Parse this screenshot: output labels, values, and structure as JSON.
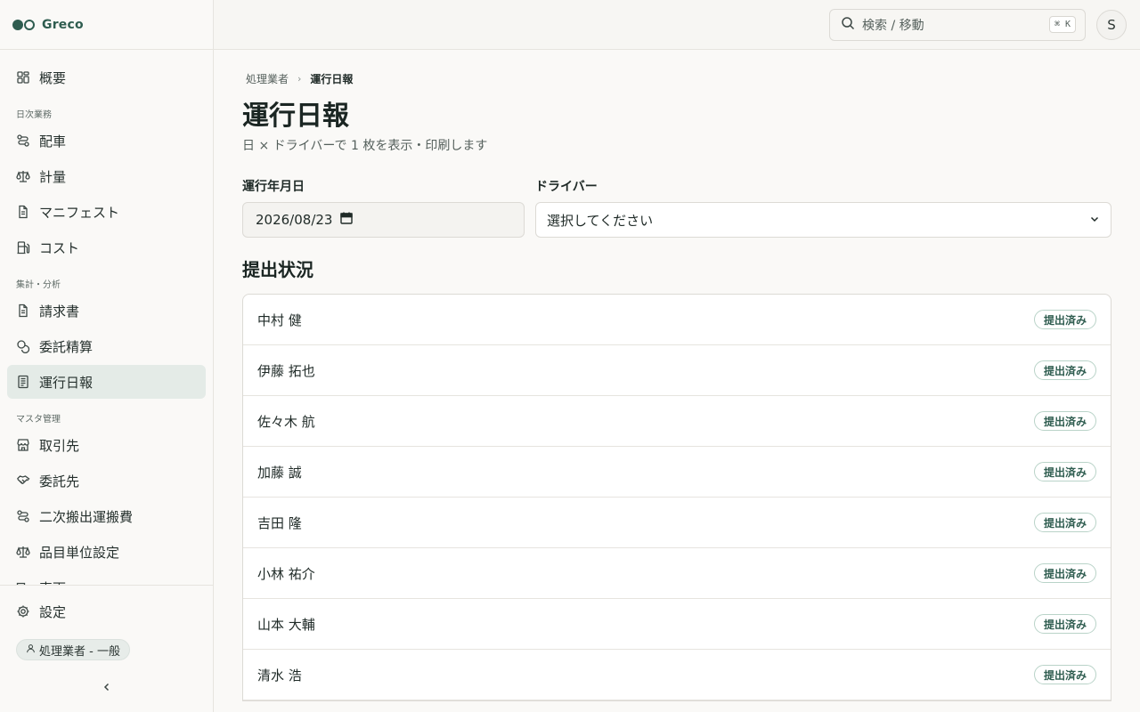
{
  "app": {
    "name": "Greco"
  },
  "sidebar": {
    "top_item": {
      "label": "概要",
      "icon": "dashboard-icon"
    },
    "groups": [
      {
        "label": "日次業務",
        "items": [
          {
            "label": "配車",
            "icon": "route-icon"
          },
          {
            "label": "計量",
            "icon": "scale-icon"
          },
          {
            "label": "マニフェスト",
            "icon": "document-icon"
          },
          {
            "label": "コスト",
            "icon": "fuel-icon"
          }
        ]
      },
      {
        "label": "集計・分析",
        "items": [
          {
            "label": "請求書",
            "icon": "document-icon"
          },
          {
            "label": "委託精算",
            "icon": "coins-icon"
          },
          {
            "label": "運行日報",
            "icon": "report-icon",
            "active": true
          }
        ]
      },
      {
        "label": "マスタ管理",
        "items": [
          {
            "label": "取引先",
            "icon": "store-icon"
          },
          {
            "label": "委託先",
            "icon": "handshake-icon"
          },
          {
            "label": "二次搬出運搬費",
            "icon": "route-icon"
          },
          {
            "label": "品目単位設定",
            "icon": "scale-icon"
          },
          {
            "label": "車両",
            "icon": "truck-icon"
          }
        ]
      }
    ],
    "footer": {
      "settings_label": "設定",
      "role_label": "処理業者 - 一般"
    }
  },
  "topbar": {
    "search_placeholder": "検索 / 移動",
    "shortcut": "⌘ K",
    "avatar_initial": "S"
  },
  "breadcrumb": {
    "parent": "処理業者",
    "current": "運行日報"
  },
  "page": {
    "title": "運行日報",
    "subtitle": "日 × ドライバーで 1 枚を表示・印刷します"
  },
  "filters": {
    "date_label": "運行年月日",
    "date_value": "2026/08/23",
    "driver_label": "ドライバー",
    "driver_value": "選択してください"
  },
  "submissions": {
    "title": "提出状況",
    "rows": [
      {
        "name": "中村 健",
        "status": "提出済み"
      },
      {
        "name": "伊藤 拓也",
        "status": "提出済み"
      },
      {
        "name": "佐々木 航",
        "status": "提出済み"
      },
      {
        "name": "加藤 誠",
        "status": "提出済み"
      },
      {
        "name": "吉田 隆",
        "status": "提出済み"
      },
      {
        "name": "小林 祐介",
        "status": "提出済み"
      },
      {
        "name": "山本 大輔",
        "status": "提出済み"
      },
      {
        "name": "清水 浩",
        "status": "提出済み"
      }
    ]
  },
  "colors": {
    "accent": "#2f5d50",
    "active_bg": "#e4ebe7",
    "border": "#dcdad5"
  }
}
